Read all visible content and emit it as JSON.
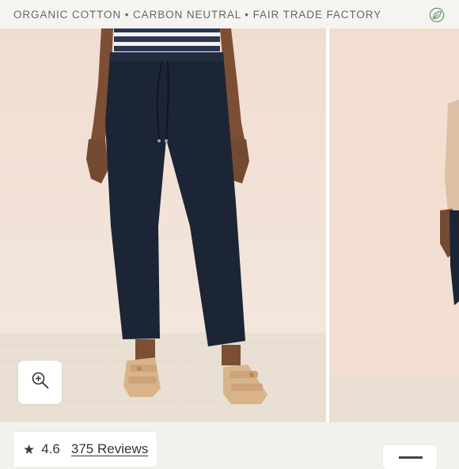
{
  "banner": {
    "text": "ORGANIC COTTON • CARBON NEUTRAL • FAIR TRADE FACTORY",
    "icon": "leaf-icon"
  },
  "gallery": {
    "zoom_icon": "zoom-in-icon"
  },
  "rating": {
    "star_icon": "star-icon",
    "value": "4.6",
    "reviews": "375 Reviews"
  },
  "colors": {
    "banner_text": "#6a6763",
    "pants": "#1c2535",
    "backdrop": "#f1ddd0",
    "floor": "#e9dfd2"
  }
}
